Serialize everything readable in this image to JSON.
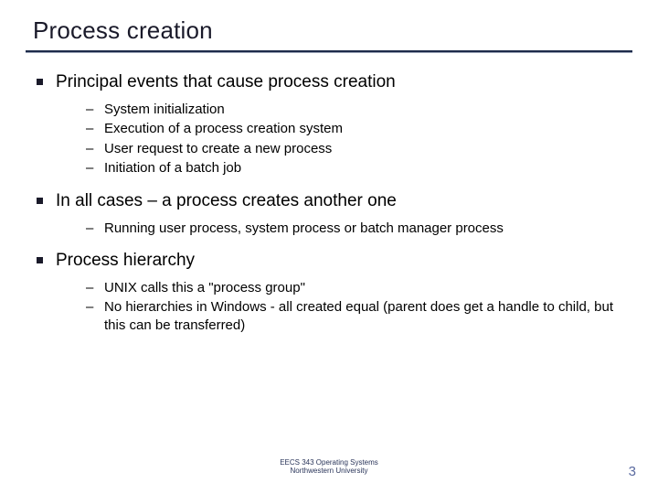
{
  "title": "Process creation",
  "bullets": [
    {
      "text": "Principal events that cause process creation",
      "subs": [
        "System initialization",
        "Execution of a process creation system",
        "User request to create a new process",
        "Initiation of a batch job"
      ]
    },
    {
      "text": "In all cases – a process creates another one",
      "subs": [
        "Running user process, system process or batch manager process"
      ]
    },
    {
      "text": "Process hierarchy",
      "subs": [
        "UNIX calls this a \"process group\"",
        "No hierarchies in Windows - all created equal (parent does get a handle to child, but this can be transferred)"
      ]
    }
  ],
  "footer": {
    "line1": "EECS 343 Operating Systems",
    "line2": "Northwestern University"
  },
  "page_number": "3"
}
